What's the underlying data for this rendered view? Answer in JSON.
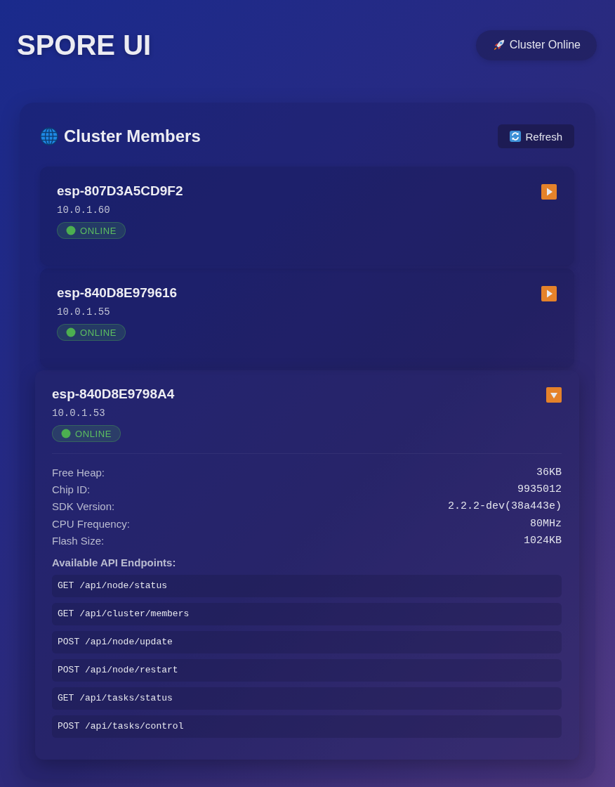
{
  "header": {
    "title": "SPORE UI",
    "status_button": "Cluster Online"
  },
  "panel": {
    "title": "Cluster Members",
    "refresh_button": "Refresh"
  },
  "members": [
    {
      "name": "esp-807D3A5CD9F2",
      "ip": "10.0.1.60",
      "status": {
        "kind": "online",
        "label": "ONLINE"
      },
      "expanded": false
    },
    {
      "name": "esp-840D8E979616",
      "ip": "10.0.1.55",
      "status": {
        "kind": "online",
        "label": "ONLINE"
      },
      "expanded": false
    },
    {
      "name": "esp-840D8E9798A4",
      "ip": "10.0.1.53",
      "status": {
        "kind": "online",
        "label": "ONLINE"
      },
      "expanded": true,
      "details": [
        {
          "label": "Free Heap:",
          "value": "36KB"
        },
        {
          "label": "Chip ID:",
          "value": "9935012"
        },
        {
          "label": "SDK Version:",
          "value": "2.2.2-dev(38a443e)"
        },
        {
          "label": "CPU Frequency:",
          "value": "80MHz"
        },
        {
          "label": "Flash Size:",
          "value": "1024KB"
        }
      ],
      "endpoints_title": "Available API Endpoints:",
      "endpoints": [
        "GET /api/node/status",
        "GET /api/cluster/members",
        "POST /api/node/update",
        "POST /api/node/restart",
        "GET /api/tasks/status",
        "POST /api/tasks/control"
      ]
    }
  ]
}
